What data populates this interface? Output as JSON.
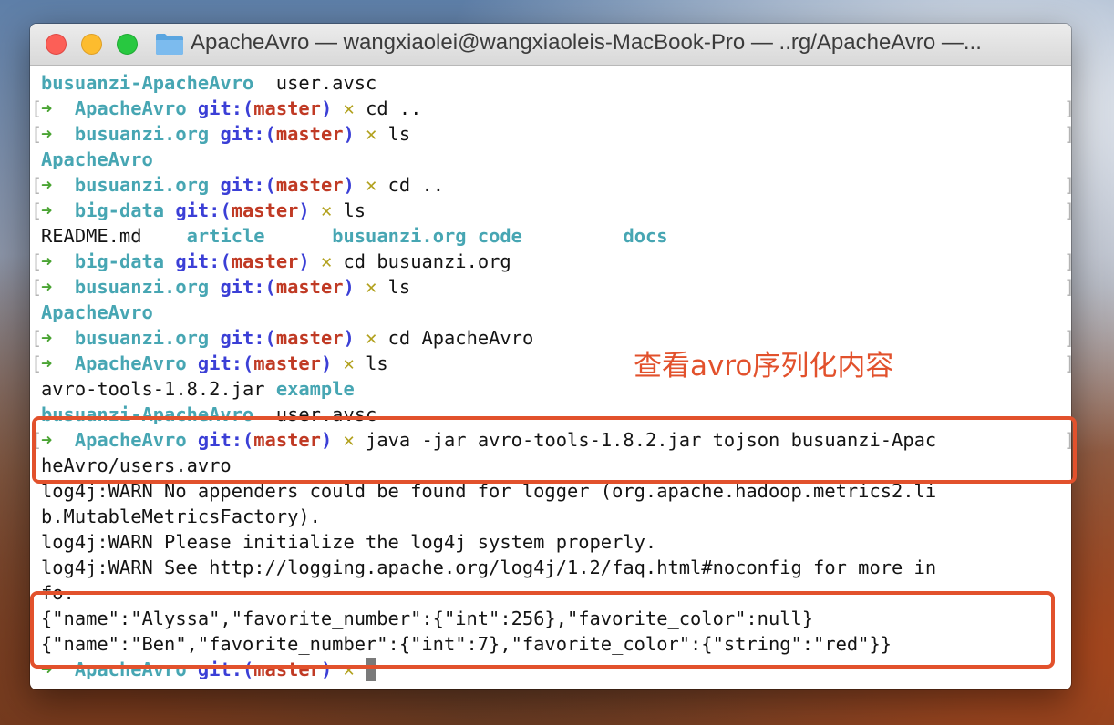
{
  "window": {
    "title": "ApacheAvro — wangxiaolei@wangxiaoleis-MacBook-Pro — ..rg/ApacheAvro —..."
  },
  "icons": {
    "close": "close-traffic-light-icon",
    "minimize": "minimize-traffic-light-icon",
    "zoom": "zoom-traffic-light-icon",
    "folder": "folder-icon",
    "prompt": "right-arrow-icon",
    "dirty": "cross-icon"
  },
  "colors": {
    "prompt_arrow": "#4aa433",
    "directory": "#47a6b3",
    "git_label": "#3b3fd6",
    "branch": "#c03a24",
    "dirty_marker": "#b2a11e",
    "annotation": "#e2512c"
  },
  "prompt": {
    "arrow": "➜",
    "git_open": "git:(",
    "branch": "master",
    "git_close": ")",
    "dirty": "✕"
  },
  "terminal": {
    "l1_a": "busuanzi-ApacheAvro",
    "l1_b": "  user.avsc",
    "l2_dir": "ApacheAvro",
    "l2_cmd": "cd ..",
    "l3_dir": "busuanzi.org",
    "l3_cmd": "ls",
    "l4": "ApacheAvro",
    "l5_dir": "busuanzi.org",
    "l5_cmd": "cd ..",
    "l6_dir": "big-data",
    "l6_cmd": "ls",
    "l7_a": "README.md",
    "l7_b": "article",
    "l7_c": "busuanzi.org",
    "l7_d": "code",
    "l7_e": "docs",
    "l8_dir": "big-data",
    "l8_cmd": "cd busuanzi.org",
    "l9_dir": "busuanzi.org",
    "l9_cmd": "ls",
    "l10": "ApacheAvro",
    "l11_dir": "busuanzi.org",
    "l11_cmd": "cd ApacheAvro",
    "l12_dir": "ApacheAvro",
    "l12_cmd": "ls",
    "l13_a": "avro-tools-1.8.2.jar",
    "l13_b": "example",
    "l14_a": "busuanzi-ApacheAvro",
    "l14_b": "  user.avsc",
    "l15_dir": "ApacheAvro",
    "l15_cmd": "java -jar avro-tools-1.8.2.jar tojson busuanzi-Apac",
    "l16": "heAvro/users.avro",
    "l17": "log4j:WARN No appenders could be found for logger (org.apache.hadoop.metrics2.li",
    "l18": "b.MutableMetricsFactory).",
    "l19": "log4j:WARN Please initialize the log4j system properly.",
    "l20": "log4j:WARN See http://logging.apache.org/log4j/1.2/faq.html#noconfig for more in",
    "l21": "fo.",
    "l22": "{\"name\":\"Alyssa\",\"favorite_number\":{\"int\":256},\"favorite_color\":null}",
    "l23": "{\"name\":\"Ben\",\"favorite_number\":{\"int\":7},\"favorite_color\":{\"string\":\"red\"}}",
    "l24_dir": "ApacheAvro"
  },
  "annotation": {
    "text": "查看avro序列化内容"
  }
}
